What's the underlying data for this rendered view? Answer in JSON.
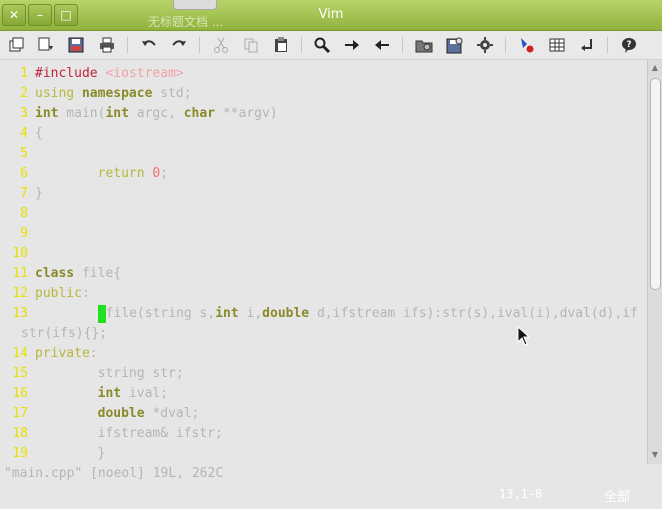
{
  "window": {
    "title": "Vim",
    "tab_hint": "无标题文档 ..."
  },
  "window_buttons": {
    "close": "✕",
    "minimize": "–",
    "maximize": "□"
  },
  "toolbar": {
    "icons": [
      "open-icon",
      "save-as-icon",
      "save-icon",
      "print-icon",
      "undo-icon",
      "redo-icon",
      "cut-icon",
      "copy-icon",
      "paste-icon",
      "find-icon",
      "find-next-icon",
      "find-prev-icon",
      "load-session-icon",
      "save-session-icon",
      "run-script-icon",
      "make-icon",
      "table-icon",
      "tags-icon",
      "help-icon"
    ]
  },
  "editor": {
    "lines": [
      {
        "n": "1",
        "parts": [
          [
            "pp",
            "#include "
          ],
          [
            "str",
            "<iostream>"
          ]
        ]
      },
      {
        "n": "2",
        "parts": [
          [
            "kw",
            "using "
          ],
          [
            "ty",
            "namespace"
          ],
          [
            "nm",
            " std;"
          ]
        ]
      },
      {
        "n": "3",
        "parts": [
          [
            "ty",
            "int"
          ],
          [
            "nm",
            " main("
          ],
          [
            "ty",
            "int"
          ],
          [
            "nm",
            " argc, "
          ],
          [
            "ty",
            "char"
          ],
          [
            "nm",
            " **argv)"
          ]
        ]
      },
      {
        "n": "4",
        "parts": [
          [
            "nm",
            "{"
          ]
        ]
      },
      {
        "n": "5",
        "parts": []
      },
      {
        "n": "6",
        "parts": [
          [
            "nm",
            "        "
          ],
          [
            "kw",
            "return "
          ],
          [
            "num",
            "0"
          ],
          [
            "nm",
            ";"
          ]
        ]
      },
      {
        "n": "7",
        "parts": [
          [
            "nm",
            "}"
          ]
        ]
      },
      {
        "n": "8",
        "parts": []
      },
      {
        "n": "9",
        "parts": []
      },
      {
        "n": "10",
        "parts": []
      },
      {
        "n": "11",
        "parts": [
          [
            "ty",
            "class"
          ],
          [
            "nm",
            " file{"
          ]
        ]
      },
      {
        "n": "12",
        "parts": [
          [
            "kw",
            "public"
          ],
          [
            "nm",
            ":"
          ]
        ]
      },
      {
        "n": "13",
        "parts": [
          [
            "nm",
            "file(string s,"
          ],
          [
            "ty",
            "int"
          ],
          [
            "nm",
            " i,"
          ],
          [
            "ty",
            "double"
          ],
          [
            "nm",
            " d,ifstream ifs):str(s),ival(i),dval(d),if"
          ]
        ],
        "cursor": true
      },
      {
        "n": "",
        "wrap": "str(ifs){};"
      },
      {
        "n": "14",
        "parts": [
          [
            "kw",
            "private"
          ],
          [
            "nm",
            ":"
          ]
        ]
      },
      {
        "n": "15",
        "parts": [
          [
            "nm",
            "        string str;"
          ]
        ]
      },
      {
        "n": "16",
        "parts": [
          [
            "nm",
            "        "
          ],
          [
            "ty",
            "int"
          ],
          [
            "nm",
            " ival;"
          ]
        ]
      },
      {
        "n": "17",
        "parts": [
          [
            "nm",
            "        "
          ],
          [
            "ty",
            "double"
          ],
          [
            "nm",
            " *dval;"
          ]
        ]
      },
      {
        "n": "18",
        "parts": [
          [
            "nm",
            "        ifstream& ifstr;"
          ]
        ]
      },
      {
        "n": "19",
        "parts": [
          [
            "nm",
            "        }"
          ]
        ]
      }
    ]
  },
  "status": {
    "command_line": "\"main.cpp\" [noeol] 19L, 262C",
    "position": "13,1-8",
    "scroll": "全部"
  },
  "colors": {
    "titlebar": "#9fc04a",
    "line_number": "#e8e000",
    "cursor": "#22e022",
    "preproc": "#c0243a"
  }
}
